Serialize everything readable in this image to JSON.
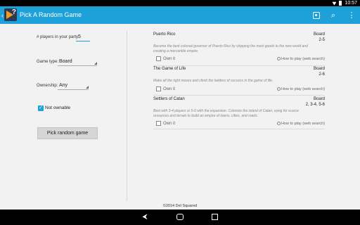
{
  "status": {
    "time": "10:57"
  },
  "app": {
    "title": "Pick A Random Game"
  },
  "form": {
    "players_label": "# players in your party:",
    "players_value": "5",
    "game_type_label": "Game type:",
    "game_type_value": "Board",
    "ownership_label": "Ownership:",
    "ownership_value": "Any",
    "not_ownable_label": "Not ownable",
    "not_ownable_checked": true,
    "pick_button": "Pick random game"
  },
  "games": [
    {
      "name": "Puerto Rico",
      "type": "Board",
      "players": "2-5",
      "description": "Become the best colonial governor of Puerto Rico by shipping the most goods to the new world and creating a mercantile empire.",
      "own_label": "Own it",
      "howto": "How to play (web search)"
    },
    {
      "name": "The Game of Life",
      "type": "Board",
      "players": "2-6",
      "description": "Make all the right moves and climb the ladders of success in the game of life.",
      "own_label": "Own it",
      "howto": "How to play (web search)"
    },
    {
      "name": "Settlers of Catan",
      "type": "Board",
      "players": "2, 3-4, 5-6",
      "description": "Best with 3-4 players or 5-6 with the expansion. Colonize the island of Catan, vying for scarce resources and terrain to build an empire of towns, cities, and roads.",
      "own_label": "Own it",
      "howto": "How to play (web search)"
    }
  ],
  "footer": {
    "copyright": "©2014 Del Squared"
  },
  "colors": {
    "accent": "#1ea0d8"
  }
}
